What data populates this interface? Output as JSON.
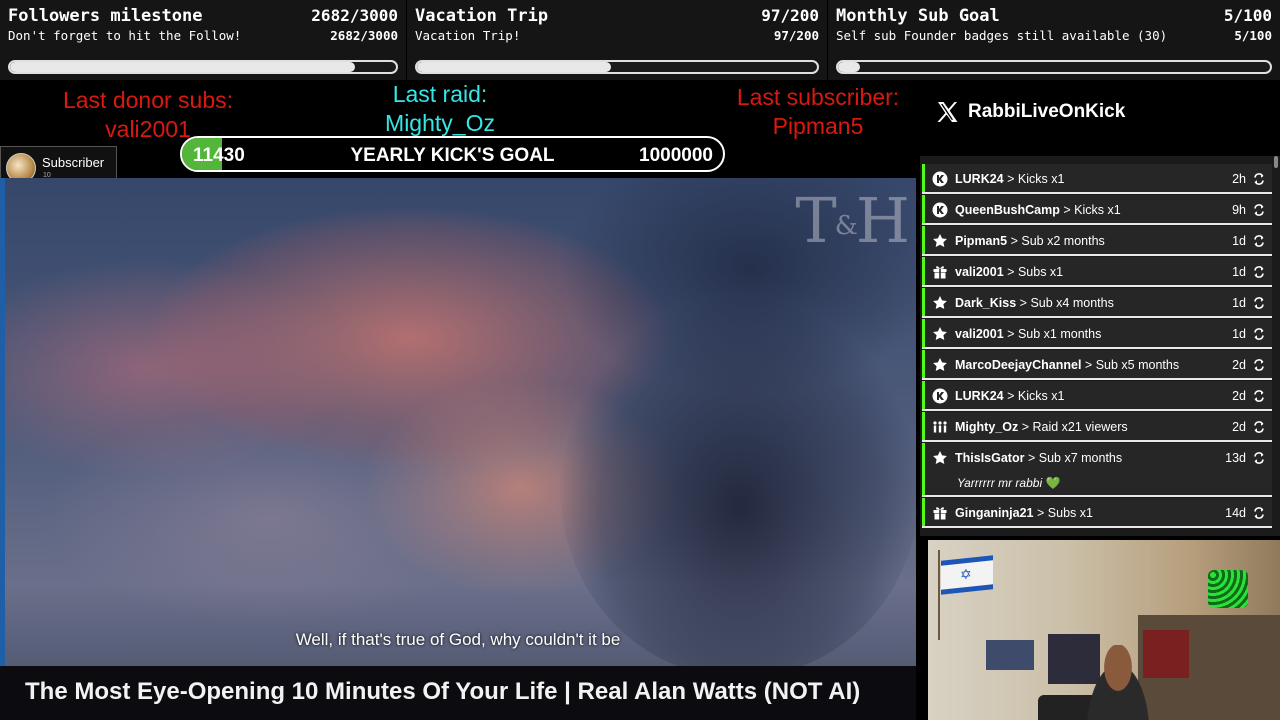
{
  "goals": [
    {
      "title": "Followers milestone",
      "subtitle": "Don't forget to hit the Follow!",
      "count": "2682/3000",
      "progress": 0.894
    },
    {
      "title": "Vacation Trip",
      "subtitle": "Vacation Trip!",
      "count": "97/200",
      "progress": 0.485
    },
    {
      "title": "Monthly Sub Goal",
      "subtitle": "Self sub Founder badges still available (30)",
      "count": "5/100",
      "progress": 0.05
    }
  ],
  "events": {
    "last_donor_label": "Last donor subs:",
    "last_donor_value": "vali2001",
    "last_raid_label": "Last raid:",
    "last_raid_value": "Mighty_Oz",
    "last_sub_label": "Last subscriber:",
    "last_sub_value": "Pipman5"
  },
  "kick_goal": {
    "current": "11430",
    "label": "YEARLY KICK'S GOAL",
    "target": "1000000",
    "progress": 0.011
  },
  "sub_badge": {
    "label": "Subscriber",
    "count": "10"
  },
  "video": {
    "watermark": "T&H",
    "watermark_t": "T",
    "watermark_amp": "&",
    "watermark_h": "H",
    "caption": "Well, if that's true of God, why couldn't it be",
    "title": "The Most Eye-Opening 10 Minutes Of Your Life | Real Alan Watts (NOT AI)"
  },
  "brand": {
    "icon": "x-logo-icon",
    "handle": "RabbiLiveOnKick"
  },
  "feed": [
    {
      "user": "LURK24",
      "action": "Kicks x1",
      "time": "2h",
      "icon": "kick-icon"
    },
    {
      "user": "QueenBushCamp",
      "action": "Kicks x1",
      "time": "9h",
      "icon": "kick-icon"
    },
    {
      "user": "Pipman5",
      "action": "Sub x2 months",
      "time": "1d",
      "icon": "star-icon"
    },
    {
      "user": "vali2001",
      "action": "Subs x1",
      "time": "1d",
      "icon": "gift-icon"
    },
    {
      "user": "Dark_Kiss",
      "action": "Sub x4 months",
      "time": "1d",
      "icon": "star-icon"
    },
    {
      "user": "vali2001",
      "action": "Sub x1 months",
      "time": "1d",
      "icon": "star-icon"
    },
    {
      "user": "MarcoDeejayChannel",
      "action": "Sub x5 months",
      "time": "2d",
      "icon": "star-icon"
    },
    {
      "user": "LURK24",
      "action": "Kicks x1",
      "time": "2d",
      "icon": "kick-icon"
    },
    {
      "user": "Mighty_Oz",
      "action": "Raid x21 viewers",
      "time": "2d",
      "icon": "raid-icon"
    },
    {
      "user": "ThisIsGator",
      "action": "Sub x7 months",
      "time": "13d",
      "icon": "star-icon",
      "message": "Yarrrrrr mr rabbi",
      "heart": "💚"
    },
    {
      "user": "Ginganinja21",
      "action": "Subs x1",
      "time": "14d",
      "icon": "gift-icon"
    }
  ],
  "feed_separator": ">",
  "colors": {
    "kick_green": "#53fc18",
    "event_red": "#d9190f",
    "event_cyan": "#35e6e6"
  }
}
